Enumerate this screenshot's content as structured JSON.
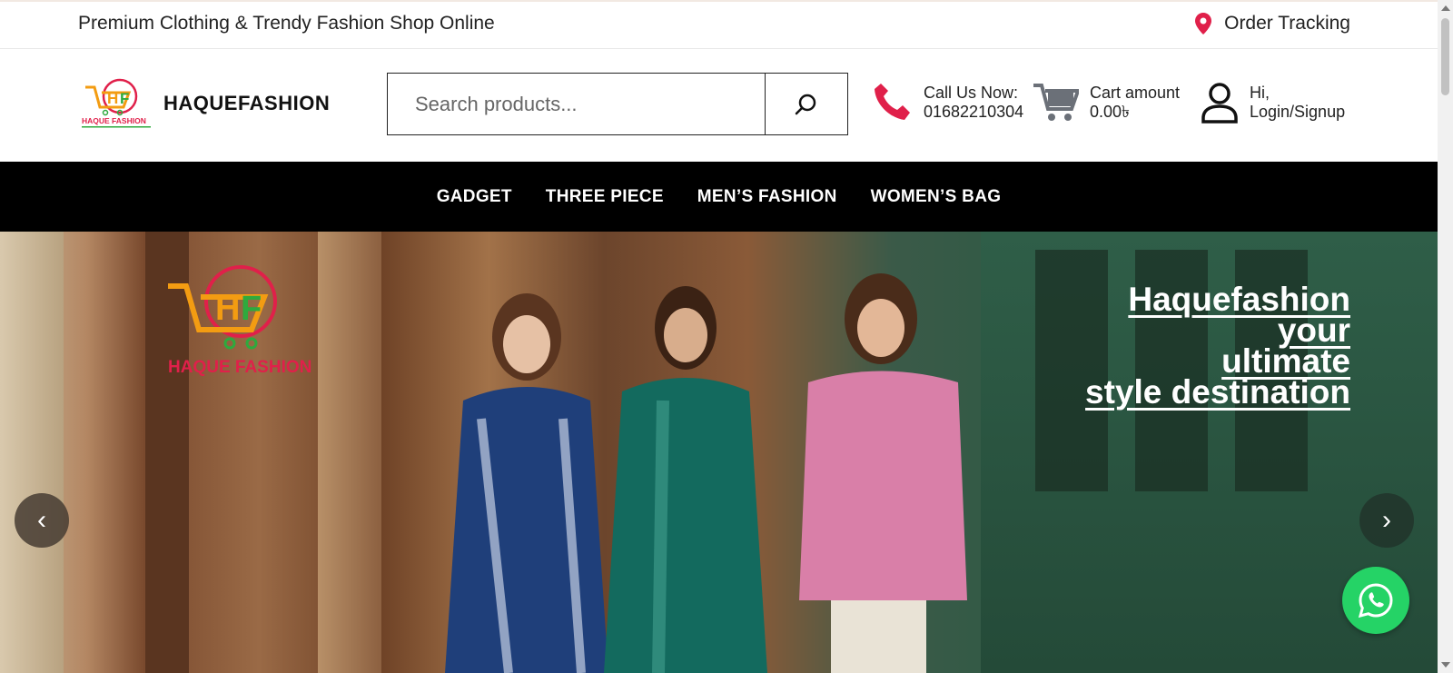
{
  "topbar": {
    "tagline": "Premium Clothing & Trendy Fashion Shop Online",
    "order_tracking": "Order Tracking",
    "accent": "#e0204a"
  },
  "header": {
    "brand": "HAQUEFASHION",
    "logo_text": "HAQUE FASHION",
    "search": {
      "placeholder": "Search products..."
    },
    "call": {
      "line1": "Call Us Now:",
      "line2": "01682210304"
    },
    "cart": {
      "line1": "Cart amount",
      "line2": "0.00৳"
    },
    "login": {
      "line1": "Hi,",
      "line2": "Login/Signup"
    },
    "phone_color": "#e0204a"
  },
  "nav": {
    "items": [
      {
        "label": "GADGET"
      },
      {
        "label": "THREE PIECE"
      },
      {
        "label": "MEN’S FASHION"
      },
      {
        "label": "WOMEN’S BAG"
      }
    ]
  },
  "hero": {
    "logo_text": "HAQUE FASHION",
    "headline": [
      "Haquefashion",
      "your",
      "ultimate",
      "style destination"
    ],
    "prev_glyph": "‹",
    "next_glyph": "›"
  },
  "icons": [
    "map-pin-icon",
    "search-icon",
    "phone-icon",
    "cart-icon",
    "user-icon",
    "whatsapp-icon",
    "chevron-left-icon",
    "chevron-right-icon"
  ]
}
